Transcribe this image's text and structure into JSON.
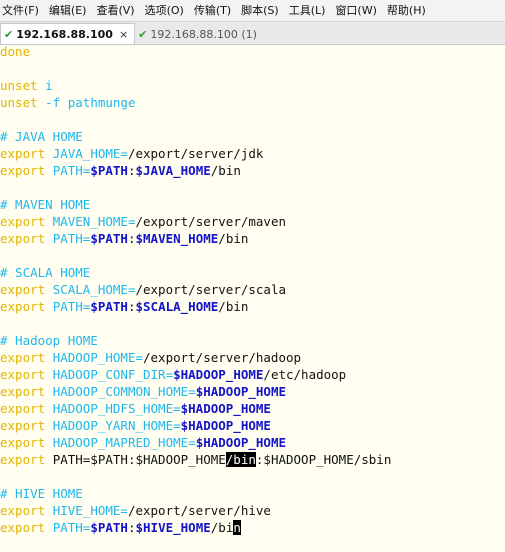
{
  "menu": {
    "items": [
      "文件(F)",
      "编辑(E)",
      "查看(V)",
      "选项(O)",
      "传输(T)",
      "脚本(S)",
      "工具(L)",
      "窗口(W)",
      "帮助(H)"
    ]
  },
  "tabs": [
    {
      "label": "192.168.88.100",
      "close": "×",
      "active": true
    },
    {
      "label": "192.168.88.100 (1)",
      "active": false
    }
  ],
  "terminal": {
    "lines": [
      [
        {
          "t": "done",
          "c": "kw"
        }
      ],
      [],
      [
        {
          "t": "unset ",
          "c": "kw"
        },
        {
          "t": "i",
          "c": "op"
        }
      ],
      [
        {
          "t": "unset ",
          "c": "kw"
        },
        {
          "t": "-f",
          "c": "op"
        },
        {
          "t": " "
        },
        {
          "t": "pathmunge",
          "c": "op"
        }
      ],
      [],
      [
        {
          "t": "# JAVA HOME",
          "c": "cmt"
        }
      ],
      [
        {
          "t": "export ",
          "c": "kw"
        },
        {
          "t": "JAVA_HOME=",
          "c": "op"
        },
        {
          "t": "/export/server/jdk"
        }
      ],
      [
        {
          "t": "export ",
          "c": "kw"
        },
        {
          "t": "PATH=",
          "c": "op"
        },
        {
          "t": "$PATH",
          "c": "var"
        },
        {
          "t": ":"
        },
        {
          "t": "$JAVA_HOME",
          "c": "var"
        },
        {
          "t": "/bin"
        }
      ],
      [],
      [
        {
          "t": "# MAVEN HOME",
          "c": "cmt"
        }
      ],
      [
        {
          "t": "export ",
          "c": "kw"
        },
        {
          "t": "MAVEN_HOME=",
          "c": "op"
        },
        {
          "t": "/export/server/maven"
        }
      ],
      [
        {
          "t": "export ",
          "c": "kw"
        },
        {
          "t": "PATH=",
          "c": "op"
        },
        {
          "t": "$PATH",
          "c": "var"
        },
        {
          "t": ":"
        },
        {
          "t": "$MAVEN_HOME",
          "c": "var"
        },
        {
          "t": "/bin"
        }
      ],
      [],
      [
        {
          "t": "# SCALA HOME",
          "c": "cmt"
        }
      ],
      [
        {
          "t": "export ",
          "c": "kw"
        },
        {
          "t": "SCALA_HOME=",
          "c": "op"
        },
        {
          "t": "/export/server/scala"
        }
      ],
      [
        {
          "t": "export ",
          "c": "kw"
        },
        {
          "t": "PATH=",
          "c": "op"
        },
        {
          "t": "$PATH",
          "c": "var"
        },
        {
          "t": ":"
        },
        {
          "t": "$SCALA_HOME",
          "c": "var"
        },
        {
          "t": "/bin"
        }
      ],
      [],
      [
        {
          "t": "# Hadoop HOME",
          "c": "cmt"
        }
      ],
      [
        {
          "t": "export ",
          "c": "kw"
        },
        {
          "t": "HADOOP_HOME=",
          "c": "op"
        },
        {
          "t": "/export/server/hadoop"
        }
      ],
      [
        {
          "t": "export ",
          "c": "kw"
        },
        {
          "t": "HADOOP_CONF_DIR=",
          "c": "op"
        },
        {
          "t": "$HADOOP_HOME",
          "c": "var"
        },
        {
          "t": "/etc/hadoop"
        }
      ],
      [
        {
          "t": "export ",
          "c": "kw"
        },
        {
          "t": "HADOOP_COMMON_HOME=",
          "c": "op"
        },
        {
          "t": "$HADOOP_HOME",
          "c": "var"
        }
      ],
      [
        {
          "t": "export ",
          "c": "kw"
        },
        {
          "t": "HADOOP_HDFS_HOME=",
          "c": "op"
        },
        {
          "t": "$HADOOP_HOME",
          "c": "var"
        }
      ],
      [
        {
          "t": "export ",
          "c": "kw"
        },
        {
          "t": "HADOOP_YARN_HOME=",
          "c": "op"
        },
        {
          "t": "$HADOOP_HOME",
          "c": "var"
        }
      ],
      [
        {
          "t": "export ",
          "c": "kw"
        },
        {
          "t": "HADOOP_MAPRED_HOME=",
          "c": "op"
        },
        {
          "t": "$HADOOP_HOME",
          "c": "var"
        }
      ],
      [
        {
          "t": "export ",
          "c": "kw"
        },
        {
          "t": "PATH=$PATH:$HADOOP_HOME"
        },
        {
          "t": "/bin",
          "c": "sel"
        },
        {
          "t": ":$HADOOP_HOME/sbin"
        }
      ],
      [],
      [
        {
          "t": "# HIVE HOME",
          "c": "cmt"
        }
      ],
      [
        {
          "t": "export ",
          "c": "kw"
        },
        {
          "t": "HIVE_HOME=",
          "c": "op"
        },
        {
          "t": "/export/server/hive"
        }
      ],
      [
        {
          "t": "export ",
          "c": "kw"
        },
        {
          "t": "PATH=",
          "c": "op"
        },
        {
          "t": "$PATH",
          "c": "var"
        },
        {
          "t": ":"
        },
        {
          "t": "$HIVE_HOME",
          "c": "var"
        },
        {
          "t": "/bi"
        },
        {
          "t": "n",
          "c": "cursor"
        }
      ]
    ]
  }
}
